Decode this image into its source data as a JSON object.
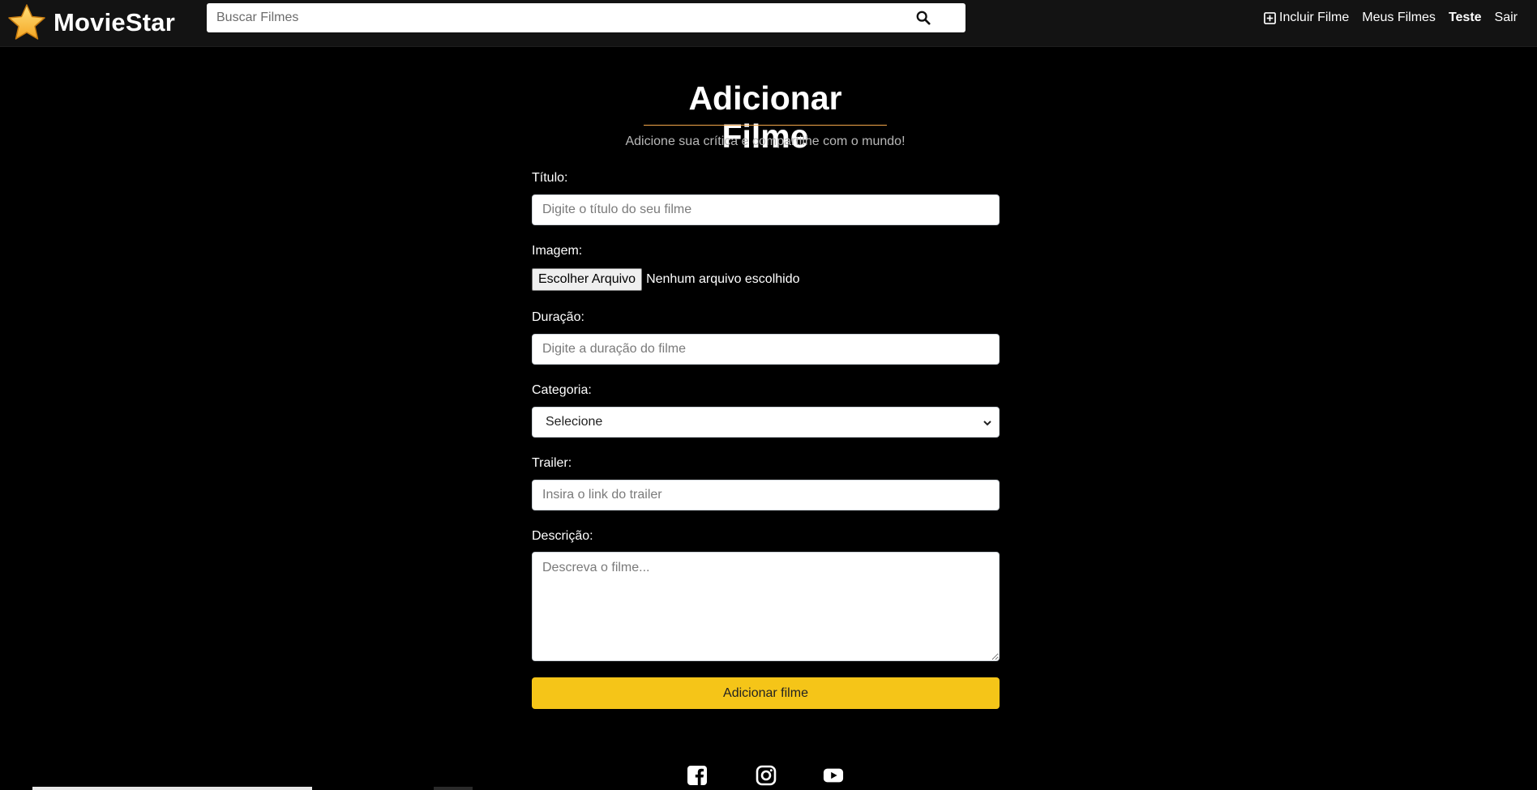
{
  "header": {
    "logo_text": "MovieStar",
    "search_placeholder": "Buscar Filmes",
    "nav": {
      "add_movie": "Incluir Filme",
      "my_movies": "Meus Filmes",
      "user": "Teste",
      "logout": "Sair"
    }
  },
  "page": {
    "title": "Adicionar Filme",
    "subtitle": "Adicione sua crítica e compartilhe com o mundo!"
  },
  "form": {
    "title_label": "Título:",
    "title_placeholder": "Digite o título do seu filme",
    "image_label": "Imagem:",
    "file_button": "Escolher Arquivo",
    "file_status": "Nenhum arquivo escolhido",
    "duration_label": "Duração:",
    "duration_placeholder": "Digite a duração do filme",
    "category_label": "Categoria:",
    "category_selected": "Selecione",
    "trailer_label": "Trailer:",
    "trailer_placeholder": "Insira o link do trailer",
    "description_label": "Descrição:",
    "description_placeholder": "Descreva o filme...",
    "submit": "Adicionar filme"
  },
  "footer": {
    "social_icons": [
      "facebook-icon",
      "instagram-icon",
      "youtube-icon"
    ]
  },
  "colors": {
    "accent": "#f5c518",
    "underline": "#f3a64a",
    "header_bg": "#131313",
    "page_bg": "#000000"
  }
}
